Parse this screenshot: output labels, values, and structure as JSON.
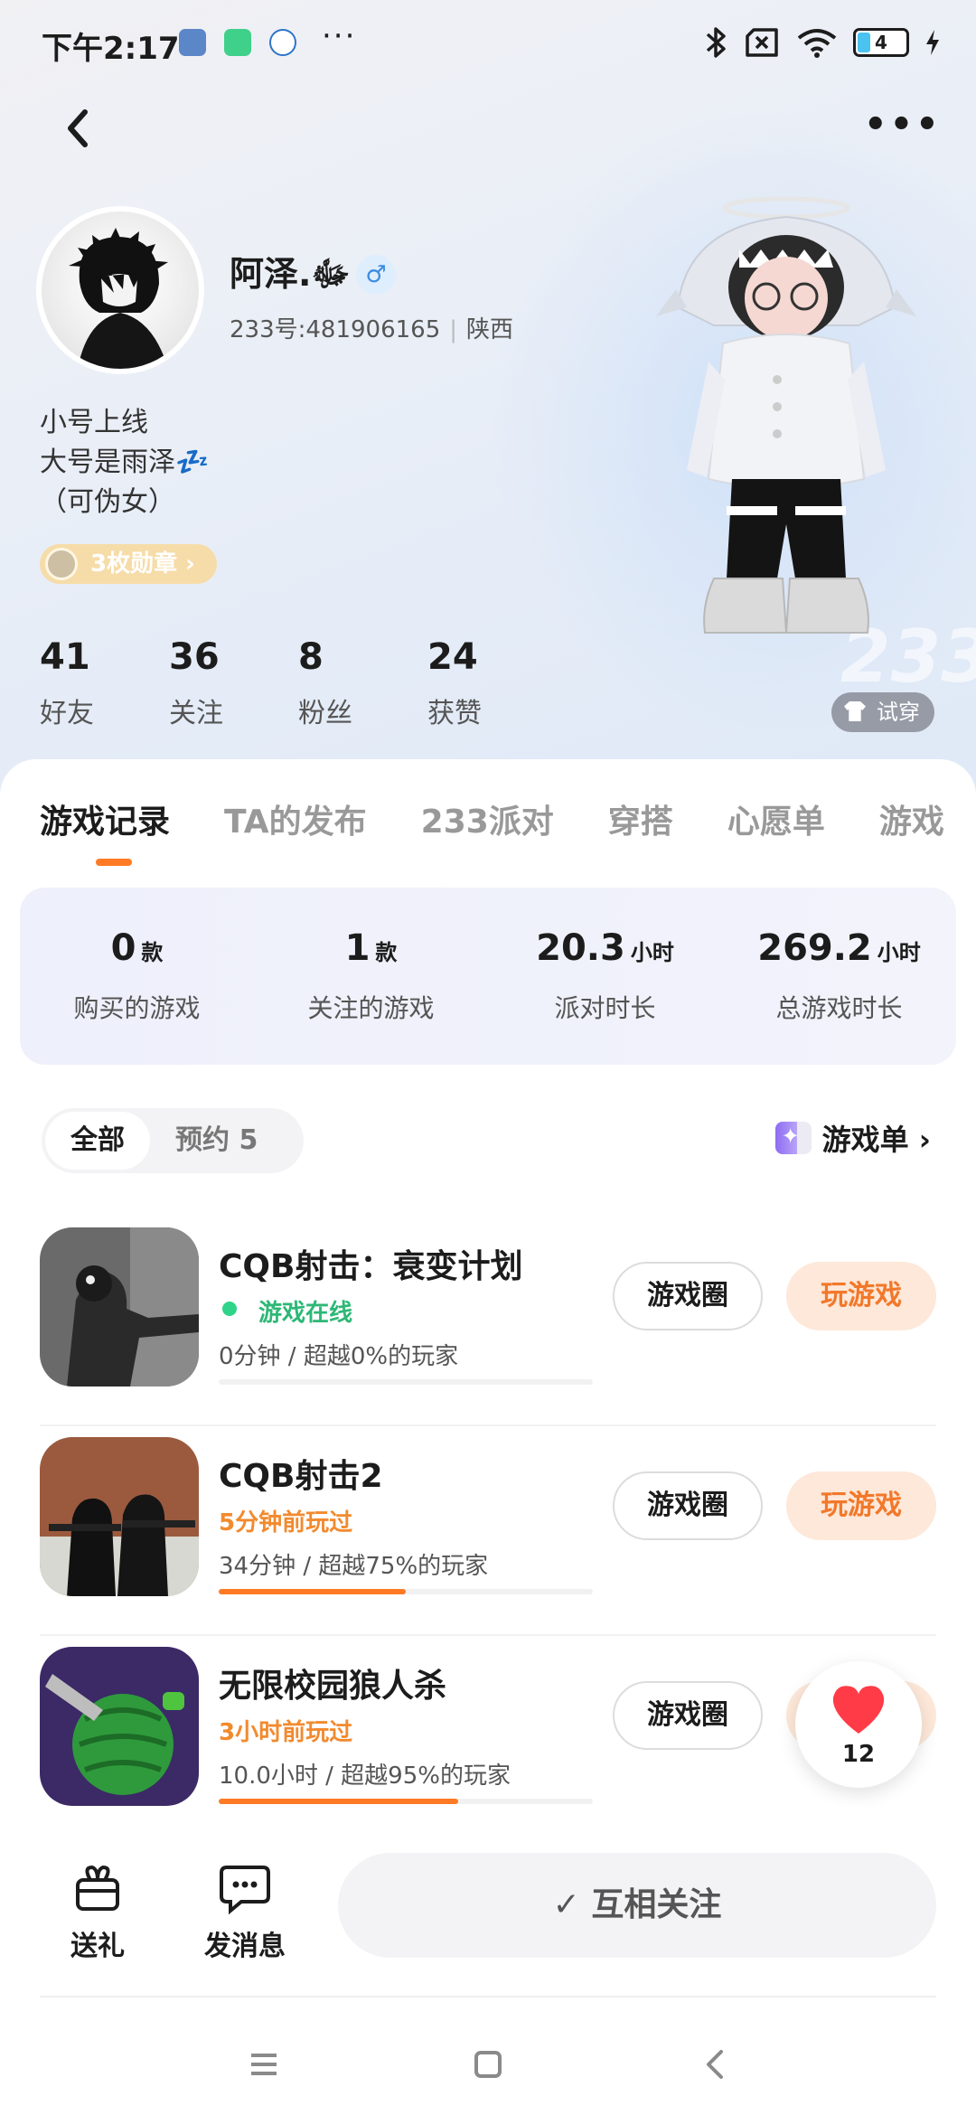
{
  "status_bar": {
    "time": "下午2:17",
    "dots": "···",
    "battery": "4"
  },
  "header": {
    "back_icon": "chevron-left-icon",
    "more_label": "•••"
  },
  "profile": {
    "nickname": "阿泽.ﷻ",
    "gender_symbol": "♂",
    "uid": "233号:481906165",
    "location": "陕西",
    "bio_lines": [
      "小号上线",
      "大号是雨泽💤",
      "（可伪女）"
    ],
    "badges_label": "3枚勋章 ›",
    "try_on_label": "试穿",
    "bg_text": "233"
  },
  "stats": [
    {
      "value": "41",
      "label": "好友"
    },
    {
      "value": "36",
      "label": "关注"
    },
    {
      "value": "8",
      "label": "粉丝"
    },
    {
      "value": "24",
      "label": "获赞"
    }
  ],
  "tabs": [
    "游戏记录",
    "TA的发布",
    "233派对",
    "穿搭",
    "心愿单",
    "游戏"
  ],
  "summary": [
    {
      "value": "0",
      "unit": "款",
      "label": "购买的游戏"
    },
    {
      "value": "1",
      "unit": "款",
      "label": "关注的游戏"
    },
    {
      "value": "20.3",
      "unit": "小时",
      "label": "派对时长"
    },
    {
      "value": "269.2",
      "unit": "小时",
      "label": "总游戏时长"
    }
  ],
  "filter": {
    "all": "全部",
    "reserved": "预约 5"
  },
  "game_list_link": "游戏单 ›",
  "games": [
    {
      "title": "CQB射击：衰变计划",
      "status": "游戏在线",
      "status_type": "online",
      "meta": "0分钟 / 超越0%的玩家",
      "progress": 0
    },
    {
      "title": "CQB射击2",
      "status": "5分钟前玩过",
      "status_type": "recent",
      "meta": "34分钟 / 超越75%的玩家",
      "progress": 0.75
    },
    {
      "title": "无限校园狼人杀",
      "status": "3小时前玩过",
      "status_type": "recent",
      "meta": "10.0小时 / 超越95%的玩家",
      "progress": 0.95
    }
  ],
  "game_buttons": {
    "circle": "游戏圈",
    "play": "玩游戏"
  },
  "like": {
    "count": "12"
  },
  "bottom": {
    "gift": "送礼",
    "message": "发消息",
    "follow": "✓ 互相关注"
  },
  "colors": {
    "accent": "#ff7a24",
    "online": "#2db876",
    "recent": "#f28a2e"
  }
}
